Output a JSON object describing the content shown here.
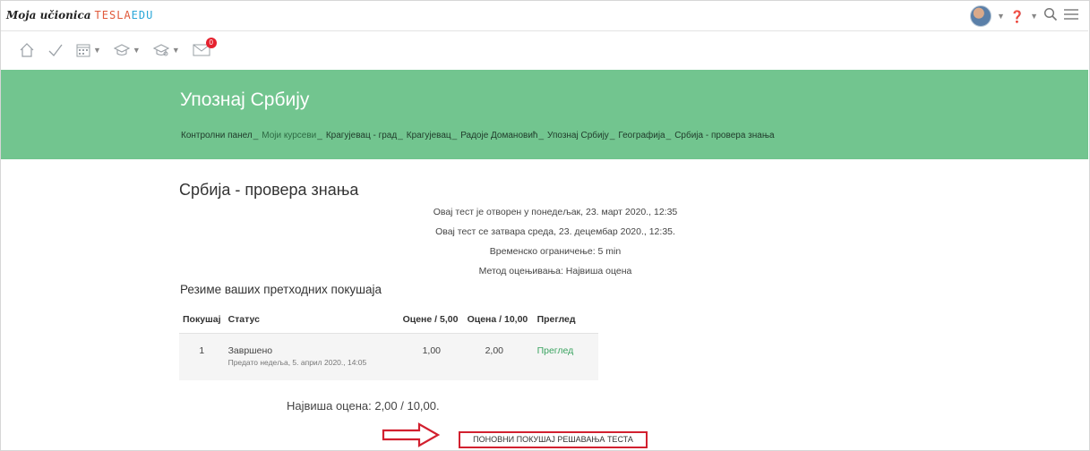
{
  "brand": {
    "script": "Moja učionica",
    "tesla": "TESLA",
    "edu": "EDU"
  },
  "subnav": {
    "notification_count": "0"
  },
  "banner": {
    "title": "Упознај Србију",
    "breadcrumbs": [
      {
        "label": "Контролни панел"
      },
      {
        "label": "Моји курсеви",
        "link": true
      },
      {
        "label": "Крагујевац - град"
      },
      {
        "label": "Крагујевац"
      },
      {
        "label": "Радоје Домановић"
      },
      {
        "label": "Упознај Србију"
      },
      {
        "label": "Географија"
      },
      {
        "label": "Србија - провера знања"
      }
    ],
    "separator": "_"
  },
  "quiz": {
    "title": "Србија - провера знања",
    "info": [
      "Овај тест је отворен у понедељак, 23. март 2020., 12:35",
      "Овај тест се затвара среда, 23. децембар 2020., 12:35.",
      "Временско ограничење: 5 min",
      "Метод оцењивања: Највиша оцена"
    ],
    "summary_heading": "Резиме ваших претходних покушаја",
    "table": {
      "headers": [
        "Покушај",
        "Статус",
        "Оцене / 5,00",
        "Оцена / 10,00",
        "Преглед"
      ],
      "rows": [
        {
          "attempt": "1",
          "status": "Завршено",
          "submitted": "Предато недеља, 5. април 2020., 14:05",
          "grade5": "1,00",
          "grade10": "2,00",
          "review": "Преглед"
        }
      ]
    },
    "highest_grade": "Највиша оцена: 2,00 / 10,00.",
    "retry_button": "ПОНОВНИ ПОКУШАЈ РЕШАВАЊА ТЕСТА"
  },
  "colors": {
    "banner": "#72c58f",
    "highlight": "#d2202f",
    "link": "#3aa360"
  }
}
